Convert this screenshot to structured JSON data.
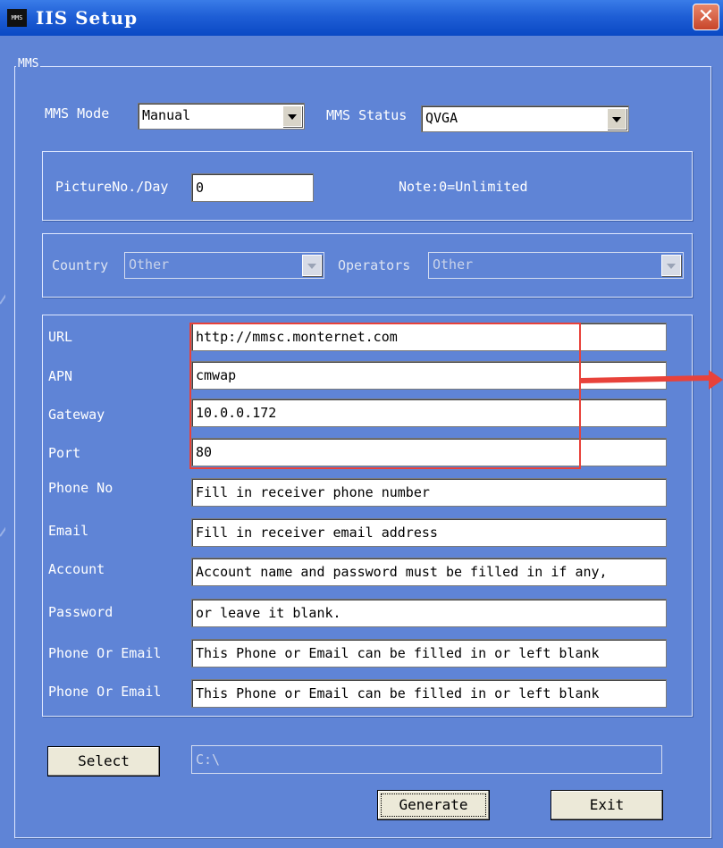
{
  "window": {
    "title": "IIS Setup",
    "icon_label": "MMS"
  },
  "mms_group": {
    "legend": "MMS"
  },
  "mode": {
    "label": "MMS Mode",
    "value": "Manual"
  },
  "status": {
    "label": "MMS Status",
    "value": "QVGA"
  },
  "picture": {
    "label": "PictureNo./Day",
    "value": "0",
    "note": "Note:0=Unlimited"
  },
  "country": {
    "label": "Country",
    "value": "Other"
  },
  "operators": {
    "label": "Operators",
    "value": "Other"
  },
  "fields": [
    {
      "label": "URL",
      "value": "http://mmsc.monternet.com"
    },
    {
      "label": "APN",
      "value": "cmwap"
    },
    {
      "label": "Gateway",
      "value": "10.0.0.172"
    },
    {
      "label": "Port",
      "value": "80"
    },
    {
      "label": "Phone No",
      "value": "Fill in receiver phone number"
    },
    {
      "label": "Email",
      "value": "Fill in receiver email address"
    },
    {
      "label": "Account",
      "value": "Account name and password must be filled in if any,"
    },
    {
      "label": "Password",
      "value": "or leave it blank."
    },
    {
      "label": "Phone Or Email",
      "value": "This Phone or Email can be filled in or left blank"
    },
    {
      "label": "Phone Or Email",
      "value": "This Phone or Email can be filled in or left blank"
    }
  ],
  "select_button": {
    "label": "Select"
  },
  "path": {
    "value": "C:\\"
  },
  "generate_button": {
    "label": "Generate"
  },
  "exit_button": {
    "label": "Exit"
  },
  "colors": {
    "annotation": "#e8423a",
    "background": "#5f84d6"
  },
  "icons": [
    "app-icon",
    "close-icon",
    "chevron-down-icon",
    "arrow-right-icon"
  ]
}
